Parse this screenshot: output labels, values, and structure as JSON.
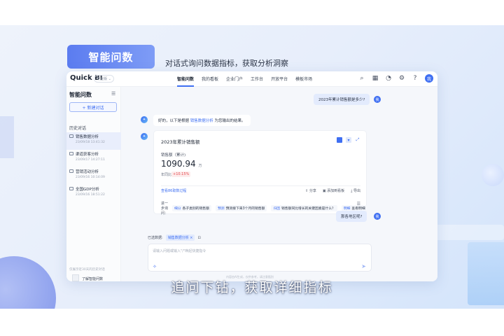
{
  "hero": {
    "badge": "智能问数",
    "subtitle": "对话式询问数据指标，获取分析洞察"
  },
  "app": {
    "logo": "Quick BI",
    "version": "专业版",
    "nav": [
      "智能问数",
      "我的看板",
      "企业门户",
      "工作台",
      "开放平台",
      "模板市场"
    ],
    "active_nav": "智能问数",
    "user_avatar": "我"
  },
  "sidebar": {
    "title": "智能问数",
    "new_chat": "+ 新建对话",
    "history_title": "历史对话",
    "items": [
      {
        "name": "销售数据分析",
        "time": "23/09/18 13:41:32"
      },
      {
        "name": "渠道获客分析",
        "time": "23/09/17 14:27:11"
      },
      {
        "name": "营销活动分析",
        "time": "23/09/16 10:14:09"
      },
      {
        "name": "全国GDP分析",
        "time": "23/09/16 18:51:22"
      }
    ],
    "footer": "仅展示近30天的历史对话",
    "doc_label": "了解智能问数"
  },
  "chat": {
    "user_q1": "2023年累计销售额是多少?",
    "bot_intro_pre": "好的，以下是根据",
    "bot_intro_link": "销售数据分析",
    "bot_intro_post": "为您输出的结果。",
    "card": {
      "title": "2023年累计销售额",
      "metric_name": "销售额（累计)",
      "value": "1090.94",
      "unit": "万",
      "yoy_label": "年同比",
      "yoy_value": "+10.15%",
      "link": "查看86取数过程",
      "actions": [
        "分享",
        "添加到看板",
        "导出"
      ],
      "follow_lead": "进一步询问：",
      "follow_ups": [
        {
          "tag": "细分",
          "text": "各子类别的销售额"
        },
        {
          "tag": "预测",
          "text": "预测接下来3个月的销售额"
        },
        {
          "tag": "归因",
          "text": "销售额同比增长的关键因素是什么？"
        },
        {
          "tag": "明细",
          "text": "查看明细"
        }
      ]
    },
    "user_q2": "那各地区呢?",
    "selected_label": "已选数据:",
    "selected_dataset": "销售数据分析",
    "input_placeholder": "请输入问题或输入\"/\"唤起快捷指令",
    "disclaimer": "内容由AI生成，仅供参考，请注意甄别"
  },
  "caption": "追问下钻，获取详细指标",
  "colors": {
    "accent": "#3f6ff2",
    "hero_badge": "#5b7cf0",
    "yoy_up": "#e5484d"
  }
}
